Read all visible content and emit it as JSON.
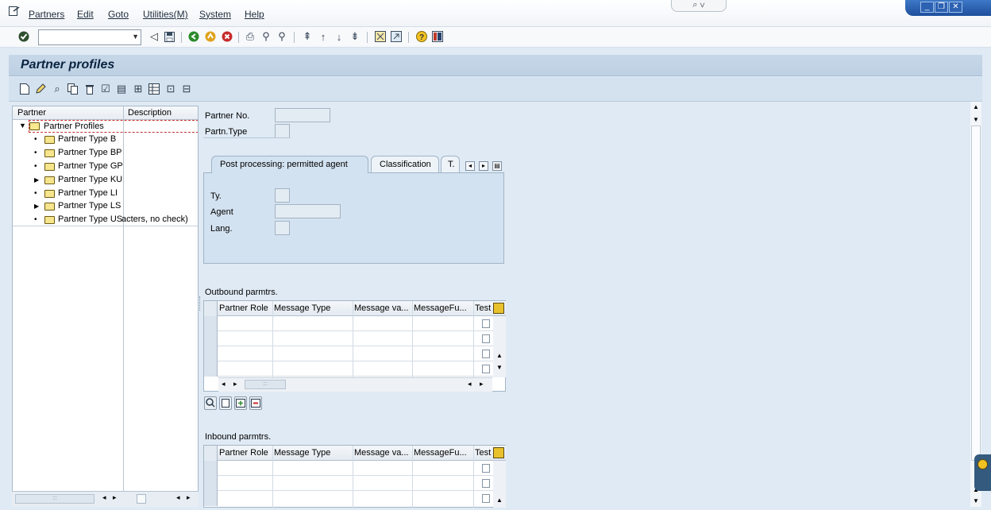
{
  "menubar": {
    "items": [
      "Partners",
      "Edit",
      "Goto",
      "Utilities(M)",
      "System",
      "Help"
    ]
  },
  "window": {
    "minimize_label": "_",
    "restore_label": "❐",
    "close_label": "✕",
    "center_tab_label": "⌕ ∨"
  },
  "std_toolbar": {
    "command_field": {
      "value": "",
      "placeholder": ""
    }
  },
  "page": {
    "title": "Partner profiles"
  },
  "tree": {
    "headers": {
      "partner": "Partner",
      "description": "Description"
    },
    "root": "Partner Profiles",
    "items": [
      {
        "label": "Partner Type B",
        "expanded": false,
        "has_children": false
      },
      {
        "label": "Partner Type BP",
        "expanded": false,
        "has_children": false
      },
      {
        "label": "Partner Type GP",
        "expanded": false,
        "has_children": false
      },
      {
        "label": "Partner Type KU",
        "expanded": false,
        "has_children": true
      },
      {
        "label": "Partner Type LI",
        "expanded": false,
        "has_children": false
      },
      {
        "label": "Partner Type LS",
        "expanded": false,
        "has_children": true
      },
      {
        "label": "Partner Type US",
        "expanded": false,
        "has_children": false,
        "description": "acters, no check)"
      }
    ]
  },
  "header_fields": {
    "partner_no_label": "Partner No.",
    "partner_no_value": "",
    "partn_type_label": "Partn.Type",
    "partn_type_value": ""
  },
  "tabs": {
    "items": [
      "Post processing: permitted agent",
      "Classification",
      "T."
    ],
    "active": 0,
    "fields": {
      "ty_label": "Ty.",
      "agent_label": "Agent",
      "lang_label": "Lang."
    }
  },
  "outbound": {
    "title": "Outbound parmtrs.",
    "columns": [
      "Partner Role",
      "Message Type",
      "Message va...",
      "MessageFu...",
      "Test"
    ],
    "rows": 4
  },
  "inbound": {
    "title": "Inbound parmtrs.",
    "columns": [
      "Partner Role",
      "Message Type",
      "Message va...",
      "MessageFu...",
      "Test"
    ],
    "rows": 3
  },
  "colors": {
    "background": "#dfeaf4",
    "title_bar": "#c6d7e8",
    "tab_body": "#d3e2f0",
    "window_controls": "#1e4f9c"
  }
}
